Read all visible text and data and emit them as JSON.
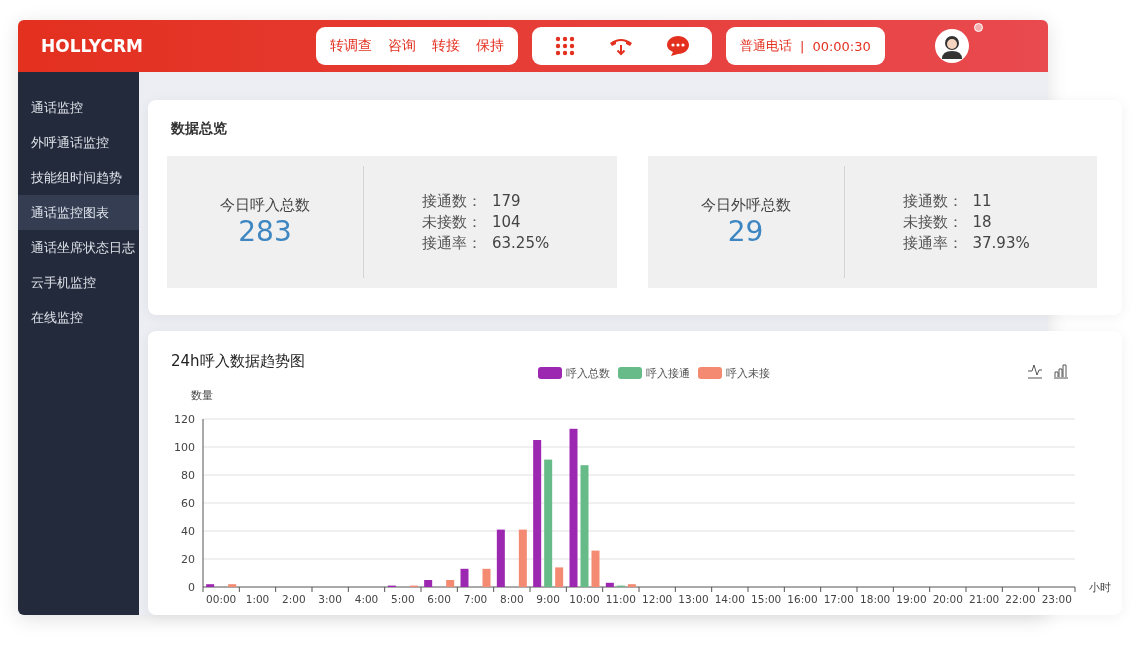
{
  "header": {
    "logo": "HOLLYCRM",
    "call_actions": [
      "转调查",
      "咨询",
      "转接",
      "保持"
    ],
    "call_type": "普通电话",
    "separator": "|",
    "duration": "00:00:30"
  },
  "sidebar": {
    "items": [
      {
        "label": "通话监控",
        "selected": false
      },
      {
        "label": "外呼通话监控",
        "selected": false
      },
      {
        "label": "技能组时间趋势",
        "selected": false
      },
      {
        "label": "通话监控图表",
        "selected": true
      },
      {
        "label": "通话坐席状态日志",
        "selected": false
      },
      {
        "label": "云手机监控",
        "selected": false
      },
      {
        "label": "在线监控",
        "selected": false
      }
    ]
  },
  "overview": {
    "title": "数据总览",
    "cards": [
      {
        "label": "今日呼入总数",
        "total": "283",
        "stats": [
          {
            "label": "接通数：",
            "value": "179"
          },
          {
            "label": "未接数：",
            "value": "104"
          },
          {
            "label": "接通率：",
            "value": "63.25%"
          }
        ]
      },
      {
        "label": "今日外呼总数",
        "total": "29",
        "stats": [
          {
            "label": "接通数：",
            "value": "11"
          },
          {
            "label": "未接数：",
            "value": "18"
          },
          {
            "label": "接通率：",
            "value": "37.93%"
          }
        ]
      }
    ]
  },
  "trend": {
    "title": "24h呼入数据趋势图",
    "chart_data": {
      "type": "bar",
      "grid": true,
      "legend": true,
      "xlabel": "小时",
      "ylabel": "数量",
      "categories": [
        "00:00",
        "1:00",
        "2:00",
        "3:00",
        "4:00",
        "5:00",
        "6:00",
        "7:00",
        "8:00",
        "9:00",
        "10:00",
        "11:00",
        "12:00",
        "13:00",
        "14:00",
        "15:00",
        "16:00",
        "17:00",
        "18:00",
        "19:00",
        "20:00",
        "21:00",
        "22:00",
        "23:00"
      ],
      "ylim": [
        0,
        120
      ],
      "yticks": [
        0,
        20,
        40,
        60,
        80,
        100,
        120
      ],
      "series": [
        {
          "name": "呼入总数",
          "color": "#9c27b0",
          "values": [
            2,
            0,
            0,
            0,
            0,
            1,
            5,
            13,
            41,
            105,
            113,
            3,
            0,
            0,
            0,
            0,
            0,
            0,
            0,
            0,
            0,
            0,
            0,
            0
          ]
        },
        {
          "name": "呼入接通",
          "color": "#66bb88",
          "values": [
            0,
            0,
            0,
            0,
            0,
            0,
            0,
            0,
            0,
            91,
            87,
            1,
            0,
            0,
            0,
            0,
            0,
            0,
            0,
            0,
            0,
            0,
            0,
            0
          ]
        },
        {
          "name": "呼入未接",
          "color": "#f48a72",
          "values": [
            2,
            0,
            0,
            0,
            0,
            1,
            5,
            13,
            41,
            14,
            26,
            2,
            0,
            0,
            0,
            0,
            0,
            0,
            0,
            0,
            0,
            0,
            0,
            0
          ]
        }
      ]
    }
  }
}
